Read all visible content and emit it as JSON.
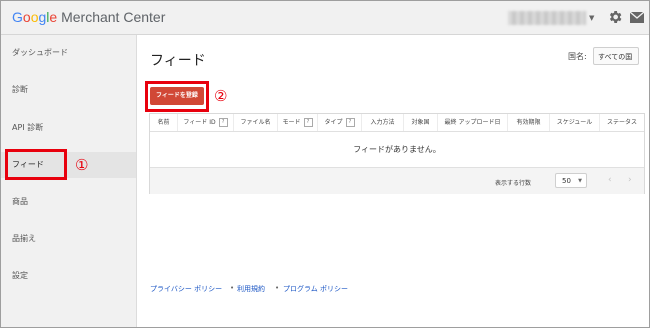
{
  "header": {
    "logo_parts": [
      "G",
      "o",
      "o",
      "g",
      "l",
      "e"
    ],
    "logo_rest": " Merchant Center",
    "icons": [
      "gear-icon",
      "mail-icon",
      "chevron-down-icon"
    ]
  },
  "sidebar": {
    "items": [
      {
        "label": "ダッシュボード"
      },
      {
        "label": "診断"
      },
      {
        "label": "API 診断"
      },
      {
        "label": "フィード"
      },
      {
        "label": "商品"
      },
      {
        "label": "品揃え"
      },
      {
        "label": "設定"
      }
    ],
    "active_index": 3
  },
  "annotations": {
    "step1": "①",
    "step2": "②"
  },
  "main": {
    "title": "フィード",
    "country_label": "国名:",
    "country_value": "すべての国",
    "add_button": "フィードを登録",
    "help_glyph": "?",
    "columns": [
      {
        "label": "名前",
        "help": false
      },
      {
        "label": "フィード ID",
        "help": true
      },
      {
        "label": "ファイル名",
        "help": false
      },
      {
        "label": "モード",
        "help": true
      },
      {
        "label": "タイプ",
        "help": true
      },
      {
        "label": "入力方法",
        "help": false
      },
      {
        "label": "対象国",
        "help": false
      },
      {
        "label": "最終 アップロード日",
        "help": false
      },
      {
        "label": "有効期限",
        "help": false
      },
      {
        "label": "スケジュール",
        "help": false
      },
      {
        "label": "ステータス",
        "help": false
      }
    ],
    "empty_message": "フィードがありません。",
    "rows_label": "表示する行数",
    "rows_value": "50",
    "pager_prev": "‹",
    "pager_next": "›"
  },
  "footer": {
    "links": [
      "プライバシー ポリシー",
      "利用規約",
      "プログラム ポリシー"
    ],
    "separator": "•"
  },
  "colors": {
    "accent": "#d14836",
    "highlight": "#e8000d",
    "link": "#1a55c4"
  }
}
